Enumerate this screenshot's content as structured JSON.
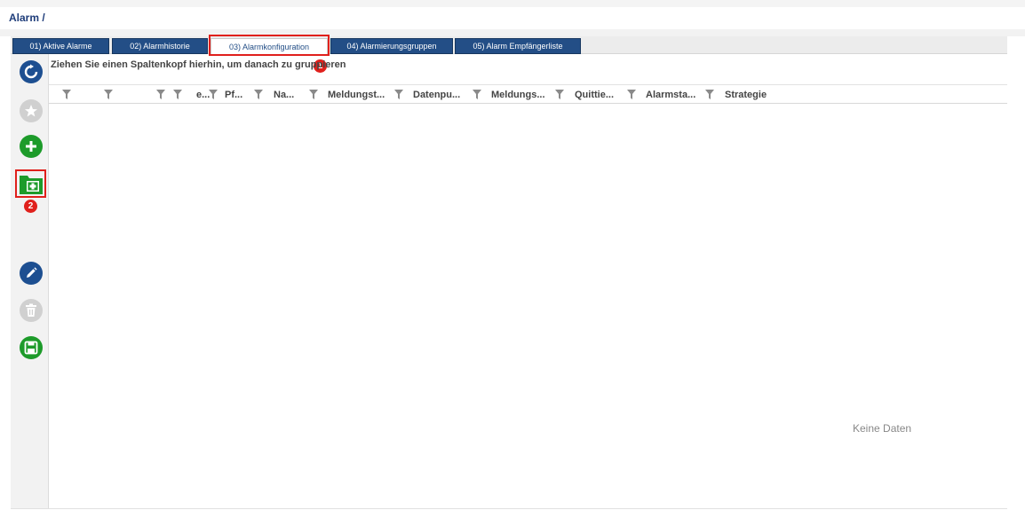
{
  "breadcrumb": "Alarm /",
  "tabs": [
    {
      "label": "01) Aktive Alarme",
      "active": false
    },
    {
      "label": "02) Alarmhistorie",
      "active": false
    },
    {
      "label": "03) Alarmkonfiguration",
      "active": true
    },
    {
      "label": "04) Alarmierungsgruppen",
      "active": false
    },
    {
      "label": "05) Alarm Empfängerliste",
      "active": false
    }
  ],
  "group_panel_hint": "Ziehen Sie einen Spaltenkopf hierhin, um danach zu gruppieren",
  "columns": [
    "",
    "",
    "",
    "e...",
    "Pf...",
    "Na...",
    "Meldungst...",
    "Datenpu...",
    "Meldungs...",
    "Quittie...",
    "Alarmsta...",
    "Strategie"
  ],
  "empty_message": "Keine Daten",
  "annotations": {
    "badge_1": "1",
    "badge_2": "2"
  },
  "toolbar": [
    {
      "icon": "refresh-icon",
      "enabled": true
    },
    {
      "icon": "star-icon",
      "enabled": false
    },
    {
      "icon": "add-icon",
      "enabled": true
    },
    {
      "icon": "folder-add-icon",
      "enabled": true
    },
    {
      "icon": "edit-icon",
      "enabled": true
    },
    {
      "icon": "trash-icon",
      "enabled": false
    },
    {
      "icon": "save-icon",
      "enabled": true
    }
  ],
  "colors": {
    "tab_bg": "#234e86",
    "primary_blue": "#1d4f91",
    "green": "#1d9b2a",
    "highlight_red": "#e0201c",
    "disabled": "#d0d0d0"
  }
}
